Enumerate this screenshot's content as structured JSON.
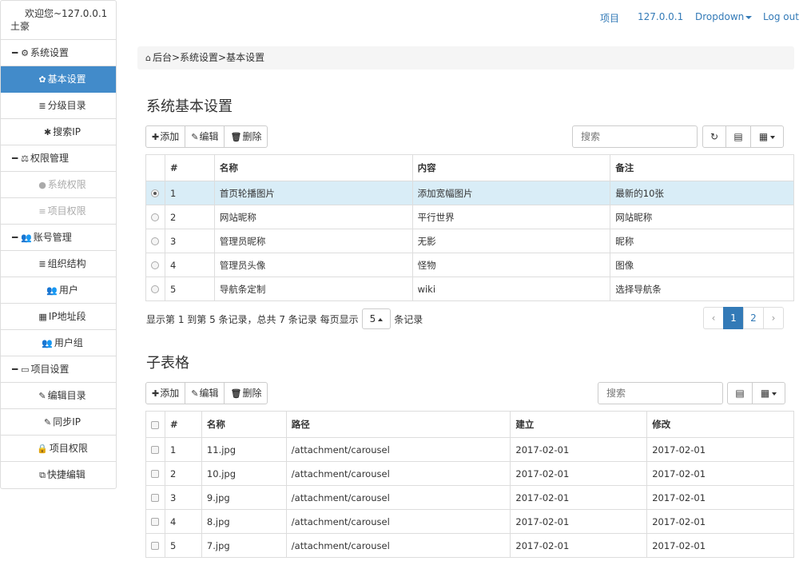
{
  "sidebar": {
    "welcome": "欢迎您~127.0.0.1土豪",
    "groups": [
      {
        "label": "系统设置",
        "items": [
          {
            "label": "基本设置",
            "icon": "gear-icon",
            "state": "active"
          },
          {
            "label": "分级目录",
            "icon": "list-icon",
            "state": "normal"
          },
          {
            "label": "搜索IP",
            "icon": "bug-icon",
            "state": "normal"
          }
        ]
      },
      {
        "label": "权限管理",
        "items": [
          {
            "label": "系统权限",
            "icon": "circle-icon",
            "state": "disabled"
          },
          {
            "label": "项目权限",
            "icon": "list-icon",
            "state": "disabled"
          }
        ]
      },
      {
        "label": "账号管理",
        "items": [
          {
            "label": "组织结构",
            "icon": "list-icon",
            "state": "normal"
          },
          {
            "label": "用户",
            "icon": "users-icon",
            "state": "normal"
          },
          {
            "label": "IP地址段",
            "icon": "grid-icon",
            "state": "normal"
          },
          {
            "label": "用户组",
            "icon": "users-icon",
            "state": "normal"
          }
        ]
      },
      {
        "label": "项目设置",
        "items": [
          {
            "label": "编辑目录",
            "icon": "edit-icon",
            "state": "normal"
          },
          {
            "label": "同步IP",
            "icon": "edit-icon",
            "state": "normal"
          },
          {
            "label": "项目权限",
            "icon": "lock-icon",
            "state": "normal"
          },
          {
            "label": "快捷编辑",
            "icon": "copy-icon",
            "state": "normal"
          }
        ]
      }
    ]
  },
  "topnav": {
    "project": "项目",
    "host": "127.0.0.1",
    "dropdown": "Dropdown",
    "logout": "Log out"
  },
  "breadcrumb": "后台>系统设置>基本设置",
  "section1": {
    "title": "系统基本设置",
    "toolbar": {
      "add": "添加",
      "edit": "编辑",
      "delete": "删除"
    },
    "search_placeholder": "搜索",
    "columns": [
      "#",
      "名称",
      "内容",
      "备注"
    ],
    "rows": [
      [
        "1",
        "首页轮播图片",
        "添加宽幅图片",
        "最新的10张"
      ],
      [
        "2",
        "网站昵称",
        "平行世界",
        "网站昵称"
      ],
      [
        "3",
        "管理员昵称",
        "无影",
        "昵称"
      ],
      [
        "4",
        "管理员头像",
        "怪物",
        "图像"
      ],
      [
        "5",
        "导航条定制",
        "wiki",
        "选择导航条"
      ]
    ],
    "selected_row": 0,
    "pagination": {
      "info_prefix": "显示第 1 到第 5 条记录，总共 7 条记录 每页显示",
      "page_size": "5",
      "info_suffix": "条记录",
      "prev": "‹",
      "pages": [
        "1",
        "2"
      ],
      "next": "›",
      "active_page": "1"
    }
  },
  "section2": {
    "title": "子表格",
    "toolbar": {
      "add": "添加",
      "edit": "编辑",
      "delete": "删除"
    },
    "search_placeholder": "搜索",
    "columns": [
      "#",
      "名称",
      "路径",
      "建立",
      "修改"
    ],
    "rows": [
      [
        "1",
        "11.jpg",
        "/attachment/carousel",
        "2017-02-01",
        "2017-02-01"
      ],
      [
        "2",
        "10.jpg",
        "/attachment/carousel",
        "2017-02-01",
        "2017-02-01"
      ],
      [
        "3",
        "9.jpg",
        "/attachment/carousel",
        "2017-02-01",
        "2017-02-01"
      ],
      [
        "4",
        "8.jpg",
        "/attachment/carousel",
        "2017-02-01",
        "2017-02-01"
      ],
      [
        "5",
        "7.jpg",
        "/attachment/carousel",
        "2017-02-01",
        "2017-02-01"
      ]
    ]
  },
  "colors": {
    "accent": "#428bca",
    "link": "#337ab7",
    "selected_row": "#d9edf7"
  }
}
